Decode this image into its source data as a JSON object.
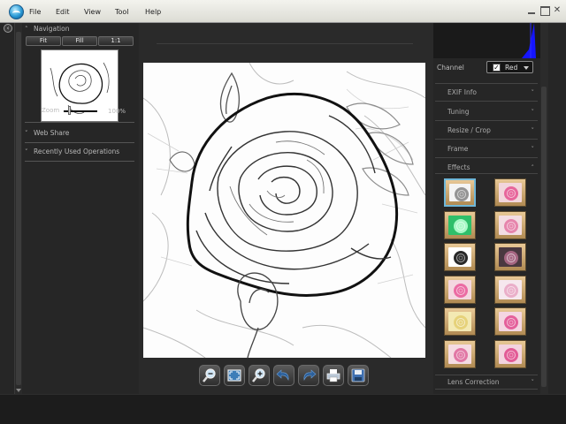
{
  "menu": {
    "items": [
      "File",
      "Edit",
      "View",
      "Tool",
      "Help"
    ]
  },
  "navigation": {
    "title": "Navigation",
    "fit_label": "Fit",
    "fill_label": "Fill",
    "one_to_one_label": "1:1",
    "zoom_label": "Zoom",
    "zoom_value": "100%"
  },
  "left_sections": {
    "web_share": "Web Share",
    "recently_used": "Recently Used Operations"
  },
  "channel": {
    "label": "Channel",
    "value": "Red",
    "checked": "✓"
  },
  "right_sections": {
    "exif": "EXIF Info",
    "tuning": "Tuning",
    "resize_crop": "Resize / Crop",
    "frame": "Frame",
    "effects": "Effects",
    "lens": "Lens Correction"
  },
  "effects": [
    {
      "name": "sketch",
      "bg": "#f4f4f4",
      "flower": "#8a8a8a"
    },
    {
      "name": "pink",
      "bg": "#f2d6dc",
      "flower": "#e65a94"
    },
    {
      "name": "green",
      "bg": "#2fbf6a",
      "flower": "#b6ffd0"
    },
    {
      "name": "pink-soft",
      "bg": "#f3dde3",
      "flower": "#e47ba5"
    },
    {
      "name": "bw-contrast",
      "bg": "#ffffff",
      "flower": "#111111"
    },
    {
      "name": "dark",
      "bg": "#4a3840",
      "flower": "#b06b8a"
    },
    {
      "name": "pink-bright",
      "bg": "#f4d7e0",
      "flower": "#ea5f9c"
    },
    {
      "name": "pale-pink",
      "bg": "#f6e8ee",
      "flower": "#e9a9c4"
    },
    {
      "name": "yellow",
      "bg": "#f3e9b3",
      "flower": "#e4cf73"
    },
    {
      "name": "magenta",
      "bg": "#f4d6e2",
      "flower": "#e25394"
    },
    {
      "name": "rose",
      "bg": "#f5dbe3",
      "flower": "#df6b9d"
    },
    {
      "name": "rose-deep",
      "bg": "#f3d3df",
      "flower": "#e04e8e"
    }
  ],
  "toolbar": [
    "zoom-out",
    "fit-screen",
    "zoom-in",
    "undo",
    "redo",
    "print",
    "save"
  ],
  "colors": {
    "accent": "#2a9ad6",
    "histogram_blue": "#1515ff"
  }
}
